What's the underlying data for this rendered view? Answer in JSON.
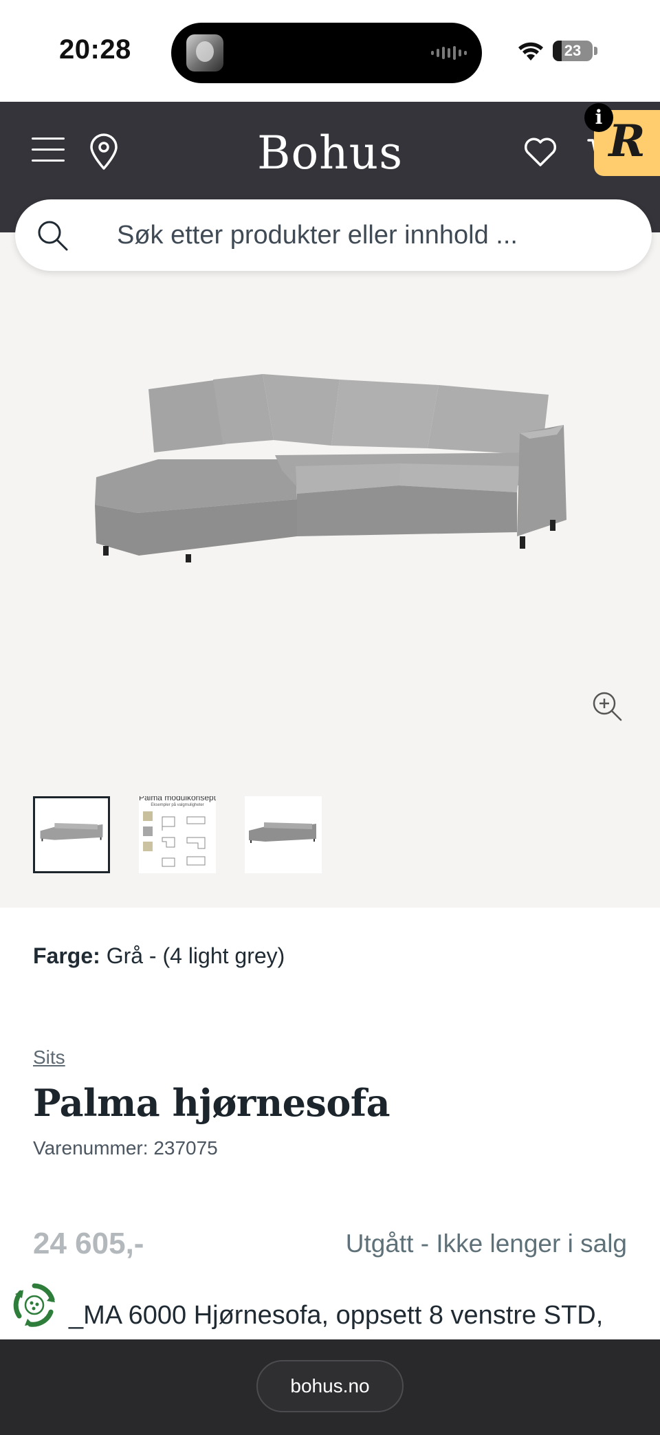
{
  "status_bar": {
    "time": "20:28",
    "battery": "23",
    "battery_level": 0.23
  },
  "header": {
    "logo": "Bohus",
    "badge_letter": "R",
    "info_glyph": "i",
    "icons": [
      "menu-icon",
      "location-pin-icon",
      "heart-icon",
      "cart-icon",
      "search-icon"
    ]
  },
  "search": {
    "placeholder": "Søk etter produkter eller innhold ..."
  },
  "gallery": {
    "thumbnail_count": 3,
    "active_thumbnail": 1,
    "brochure_heading": "Palma modulkonsept",
    "brochure_subheading": "Eksempler på valgmuligheter"
  },
  "product": {
    "color_label": "Farge:",
    "color_value": "Grå - (4 light grey)",
    "category": "Sits",
    "title": "Palma hjørnesofa",
    "sku": "Varenummer: 237075",
    "price": "24 605,-",
    "availability": "Utgått - Ikke lenger i salg",
    "description": "_MA 6000 Hjørnesofa, oppsett 8 venstre STD,"
  },
  "colors": {
    "header_bg": "#35343a",
    "gallery_bg": "#f5f4f2",
    "badge": "#ffcd6e",
    "price_muted": "#b3b8bc",
    "status_text": "#5f7178",
    "browser_bar": "#29292b"
  },
  "browser": {
    "url": "bohus.no"
  }
}
